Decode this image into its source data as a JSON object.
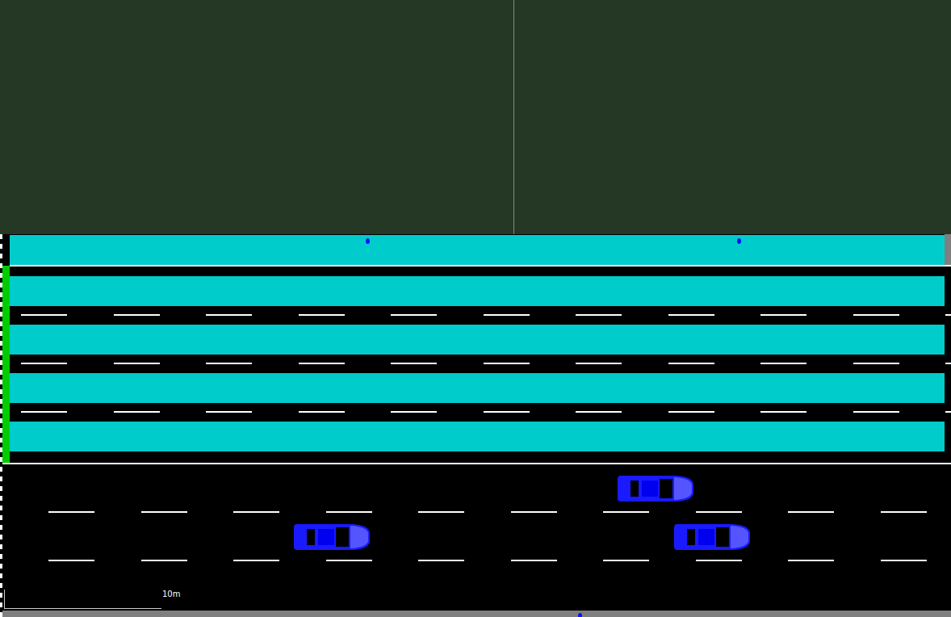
{
  "scale_bar": {
    "label": "10m"
  },
  "crossing": {
    "walk_lanes": 4
  },
  "road": {
    "lanes": 3
  },
  "vehicles": [
    {
      "lane": 0,
      "position": 0.65
    },
    {
      "lane": 1,
      "position": 0.31
    },
    {
      "lane": 1,
      "position": 0.71
    }
  ]
}
